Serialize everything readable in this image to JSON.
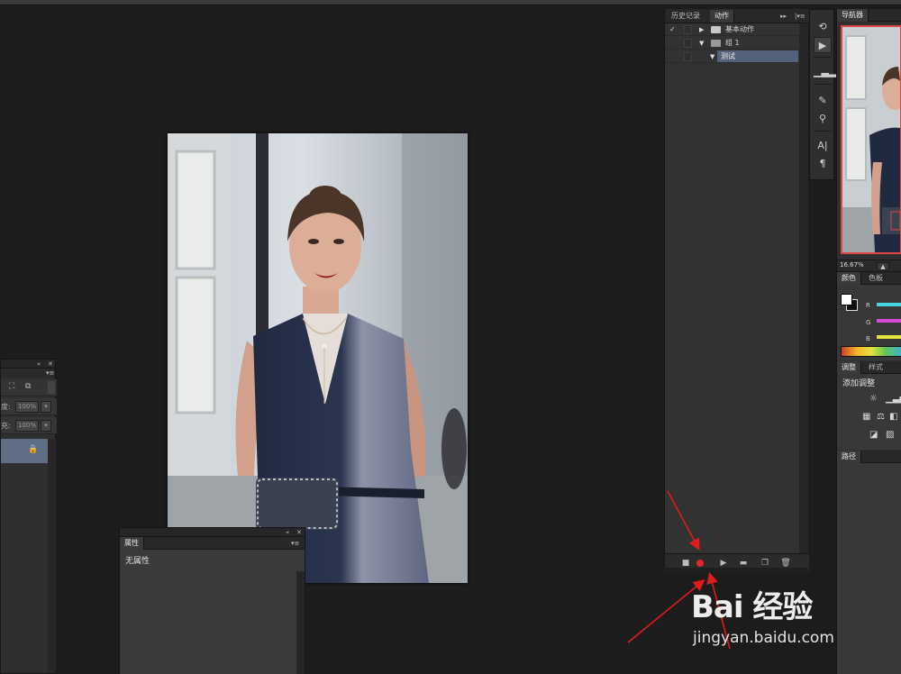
{
  "actions_panel": {
    "tabs": [
      "历史记录",
      "动作"
    ],
    "rows": [
      {
        "label": "基本动作",
        "checked": true,
        "expanded": false,
        "level": 0
      },
      {
        "label": "组 1",
        "checked": false,
        "expanded": true,
        "level": 0
      },
      {
        "label": "测试",
        "checked": false,
        "expanded": true,
        "level": 1,
        "selected": true
      }
    ],
    "toolbar": [
      "stop-icon",
      "record-icon",
      "play-icon",
      "folder-icon",
      "new-action-icon",
      "trash-icon"
    ],
    "record_color": "#e5262c"
  },
  "properties_panel": {
    "tab": "属性",
    "text": "无属性"
  },
  "layers_panel": {
    "opacity_label": "度:",
    "opacity_value": "100%",
    "fill_label": "充:",
    "fill_value": "100%"
  },
  "navigator": {
    "tab": "导航器",
    "zoom": "16.67%"
  },
  "color_panel": {
    "tabs": [
      "颜色",
      "色板"
    ],
    "channels": [
      {
        "name": "R",
        "color": "#46d4e0"
      },
      {
        "name": "G",
        "color": "#d64ad6"
      },
      {
        "name": "B",
        "color": "#e6e63a"
      }
    ]
  },
  "adjustments_panel": {
    "tabs": [
      "调整",
      "样式"
    ],
    "add_text": "添加调整"
  },
  "paths_panel": {
    "tab": "路径"
  },
  "watermark": {
    "brand": "Bai 经验",
    "url": "jingyan.baidu.com"
  },
  "annotation_color": "#e01b1b"
}
